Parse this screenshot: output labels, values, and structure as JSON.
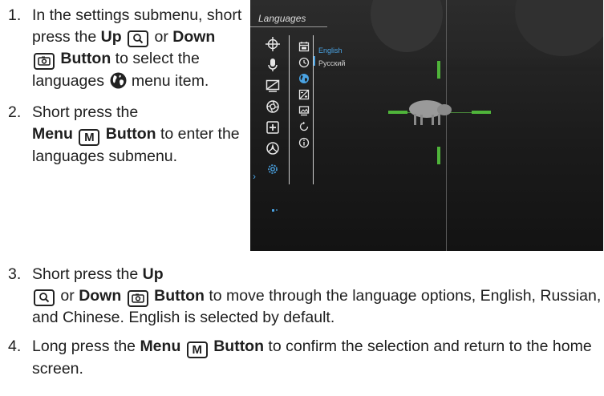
{
  "instructions": {
    "step1": {
      "number": "1.",
      "t1": "In the settings submenu, short press the ",
      "up": "Up",
      "or": " or ",
      "down": "Down",
      "button": "Button",
      "t2": " to select the languages ",
      "t3": " menu item."
    },
    "step2": {
      "number": "2.",
      "t1": "Short press the ",
      "menu": "Menu",
      "m_key": "M",
      "button": "Button",
      "t2": " to enter the languages submenu."
    },
    "step3": {
      "number": "3.",
      "t1": "Short press the ",
      "up": "Up",
      "or": " or ",
      "down": "Down",
      "button": "Button",
      "t2": " to move through the language options, English, Russian, and Chinese. English is selected by default."
    },
    "step4": {
      "number": "4.",
      "t1": "Long press the ",
      "menu": "Menu",
      "m_key": "M",
      "button": "Button",
      "t2": " to confirm the selection and return to the home screen."
    }
  },
  "device_screen": {
    "menu_title": "Languages",
    "languages": [
      "English",
      "Русский"
    ],
    "selected_language": "English",
    "accent_color": "#4aa3e3",
    "reticle_color": "#4fb43a",
    "main_menu_icons": [
      "crosshair-icon",
      "microphone-icon",
      "display-icon",
      "aperture-icon",
      "plus-box-icon",
      "compass-icon",
      "settings-gear-icon"
    ],
    "sub_menu_icons": [
      "calendar-icon",
      "clock-icon",
      "globe-icon",
      "brightness-icon",
      "image-icon",
      "reset-icon",
      "info-icon"
    ]
  }
}
